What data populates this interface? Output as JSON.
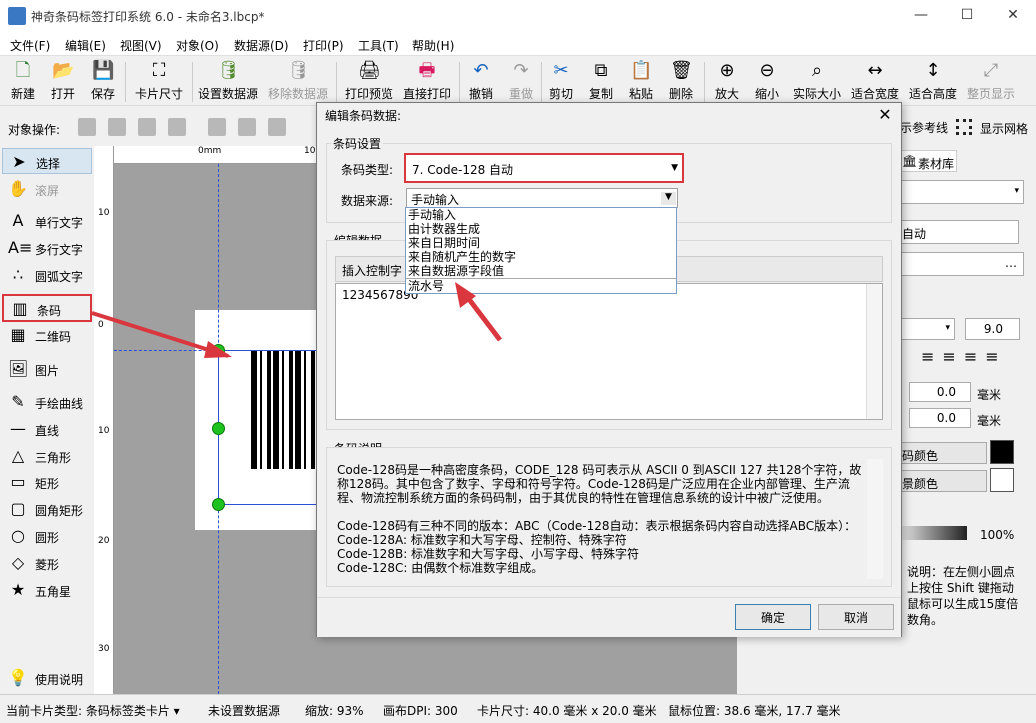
{
  "window": {
    "title": "神奇条码标签打印系统 6.0 - 未命名3.lbcp*",
    "minimize": "—",
    "maximize": "☐",
    "close": "✕"
  },
  "menu": [
    "文件(F)",
    "编辑(E)",
    "视图(V)",
    "对象(O)",
    "数据源(D)",
    "打印(P)",
    "工具(T)",
    "帮助(H)"
  ],
  "toolbar": [
    {
      "label": "新建",
      "icon": "new-file-icon",
      "glyph": "🗋"
    },
    {
      "label": "打开",
      "icon": "open-icon",
      "glyph": "📂"
    },
    {
      "label": "保存",
      "icon": "save-icon",
      "glyph": "💾"
    },
    {
      "label": "卡片尺寸",
      "icon": "card-size-icon",
      "glyph": "⛶"
    },
    {
      "label": "设置数据源",
      "icon": "database-icon",
      "glyph": "🛢"
    },
    {
      "label": "移除数据源",
      "icon": "database-remove-icon",
      "glyph": "🛢"
    },
    {
      "label": "打印预览",
      "icon": "print-preview-icon",
      "glyph": "🖨"
    },
    {
      "label": "直接打印",
      "icon": "print-icon",
      "glyph": "🖶"
    },
    {
      "label": "撤销",
      "icon": "undo-icon",
      "glyph": "↶"
    },
    {
      "label": "重做",
      "icon": "redo-icon",
      "glyph": "↷"
    },
    {
      "label": "剪切",
      "icon": "cut-icon",
      "glyph": "✂"
    },
    {
      "label": "复制",
      "icon": "copy-icon",
      "glyph": "⧉"
    },
    {
      "label": "粘贴",
      "icon": "paste-icon",
      "glyph": "📋"
    },
    {
      "label": "删除",
      "icon": "delete-icon",
      "glyph": "🗑"
    },
    {
      "label": "放大",
      "icon": "zoom-in-icon",
      "glyph": "⊕"
    },
    {
      "label": "缩小",
      "icon": "zoom-out-icon",
      "glyph": "⊖"
    },
    {
      "label": "实际大小",
      "icon": "actual-size-icon",
      "glyph": "⌕"
    },
    {
      "label": "适合宽度",
      "icon": "fit-width-icon",
      "glyph": "↔"
    },
    {
      "label": "适合高度",
      "icon": "fit-height-icon",
      "glyph": "↕"
    },
    {
      "label": "整页显示",
      "icon": "full-page-icon",
      "glyph": "⤢"
    }
  ],
  "objbar": {
    "label": "对象操作:",
    "show_guides": "示参考线",
    "show_grid": "显示网格"
  },
  "tools": [
    {
      "label": "选择",
      "icon": "pointer-icon",
      "glyph": "➤"
    },
    {
      "label": "滚屏",
      "icon": "hand-icon",
      "glyph": "✋"
    },
    {
      "label": "单行文字",
      "icon": "single-text-icon",
      "glyph": "A"
    },
    {
      "label": "多行文字",
      "icon": "multi-text-icon",
      "glyph": "A≡"
    },
    {
      "label": "圆弧文字",
      "icon": "arc-text-icon",
      "glyph": "∴"
    },
    {
      "label": "条码",
      "icon": "barcode-icon",
      "glyph": "▥"
    },
    {
      "label": "二维码",
      "icon": "qrcode-icon",
      "glyph": "▦"
    },
    {
      "label": "图片",
      "icon": "image-icon",
      "glyph": "🖼"
    },
    {
      "label": "手绘曲线",
      "icon": "pen-icon",
      "glyph": "✎"
    },
    {
      "label": "直线",
      "icon": "line-icon",
      "glyph": "—"
    },
    {
      "label": "三角形",
      "icon": "triangle-icon",
      "glyph": "△"
    },
    {
      "label": "矩形",
      "icon": "rectangle-icon",
      "glyph": "▭"
    },
    {
      "label": "圆角矩形",
      "icon": "rounded-rect-icon",
      "glyph": "▢"
    },
    {
      "label": "圆形",
      "icon": "circle-icon",
      "glyph": "○"
    },
    {
      "label": "菱形",
      "icon": "diamond-icon",
      "glyph": "◇"
    },
    {
      "label": "五角星",
      "icon": "star-icon",
      "glyph": "★"
    },
    {
      "label": "使用说明",
      "icon": "bulb-icon",
      "glyph": "💡"
    }
  ],
  "ruler": {
    "h": [
      "0mm",
      "10"
    ],
    "v": [
      "10",
      "0",
      "10",
      "20",
      "30"
    ]
  },
  "right_panel": {
    "tab": "素材库",
    "font_prop": "自动",
    "font_size": "9.0",
    "x_value": "0.0",
    "y_value": "0.0",
    "unit": "毫米",
    "barcode_color": "码颜色",
    "bg_color": "景颜色",
    "opacity": "100%",
    "hint": "说明：在左侧小圆点上按住 Shift 键拖动鼠标可以生成15度倍数角。"
  },
  "status": {
    "card_type": "当前卡片类型: 条码标签类卡片 ▾",
    "datasource": "未设置数据源",
    "zoom": "缩放: 93%",
    "dpi": "画布DPI: 300",
    "card_size": "卡片尺寸: 40.0 毫米 x 20.0 毫米",
    "mouse": "鼠标位置: 38.6 毫米, 17.7 毫米"
  },
  "dialog": {
    "title": "编辑条码数据:",
    "close": "✕",
    "barcode_settings": "条码设置",
    "type_label": "条码类型:",
    "type_value": "7. Code-128 自动",
    "source_label": "数据来源:",
    "source_value": "手动输入",
    "source_options": [
      "手动输入",
      "由计数器生成",
      "来自日期时间",
      "来自随机产生的数字",
      "来自数据源字段值",
      "流水号"
    ],
    "edit_data": "编辑数据",
    "insert_ctrl": "插入控制字",
    "data_value": "1234567890",
    "desc_title": "条码说明",
    "desc_p1": "Code-128码是一种高密度条码，CODE_128 码可表示从 ASCII 0 到ASCII 127 共128个字符，故称128码。其中包含了数字、字母和符号字符。Code-128码是广泛应用在企业内部管理、生产流程、物流控制系统方面的条码码制，由于其优良的特性在管理信息系统的设计中被广泛使用。",
    "desc_p2": "Code-128码有三种不同的版本：ABC（Code-128自动：表示根据条码内容自动选择ABC版本）：",
    "desc_p3": "Code-128A: 标准数字和大写字母、控制符、特殊字符",
    "desc_p4": "Code-128B: 标准数字和大写字母、小写字母、特殊字符",
    "desc_p5": "Code-128C: 由偶数个标准数字组成。",
    "ok": "确定",
    "cancel": "取消"
  },
  "colors": {
    "accent_red": "#d9363e",
    "guide_blue": "#2c4fd6",
    "handle_green": "#1ec21e"
  }
}
